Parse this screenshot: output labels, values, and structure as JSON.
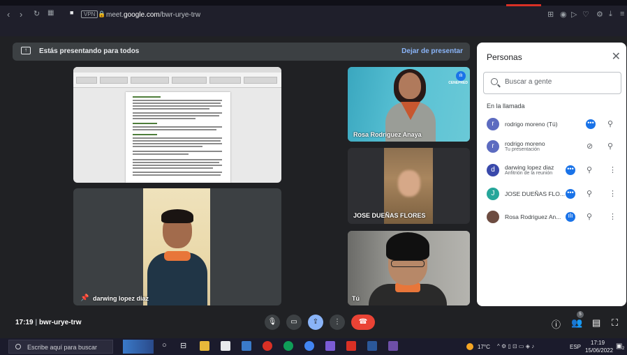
{
  "browser": {
    "url_prefix": "meet.",
    "url_domain": "google.com",
    "url_path": "/bwr-urye-trw",
    "vpn_label": "VPN"
  },
  "banner": {
    "text": "Estás presentando para todos",
    "stop_label": "Dejar de presentar"
  },
  "tiles": {
    "rosa": "Rosa Rodriguez Anaya",
    "rosa_logo": "CENEPRED",
    "jose": "JOSE DUEÑAS FLORES",
    "darwing": "darwing lopez diaz",
    "you": "Tú"
  },
  "people": {
    "title": "Personas",
    "search_placeholder": "Buscar a gente",
    "in_call": "En la llamada",
    "list": [
      {
        "initial": "r",
        "name": "rodrigo moreno (Tú)",
        "sub": "",
        "color": "#5c6bc0"
      },
      {
        "initial": "r",
        "name": "rodrigo moreno",
        "sub": "Tu presentación",
        "color": "#5c6bc0"
      },
      {
        "initial": "d",
        "name": "darwing lopez diaz",
        "sub": "Anfitrión de la reunión",
        "color": "#3949ab"
      },
      {
        "initial": "J",
        "name": "JOSE DUEÑAS FLO...",
        "sub": "",
        "color": "#26a69a"
      },
      {
        "initial": "",
        "name": "Rosa Rodriguez An...",
        "sub": "",
        "color": "#6d4c41"
      }
    ]
  },
  "meeting": {
    "time": "17:19",
    "separator": "|",
    "code": "bwr-urye-trw",
    "participants": "5"
  },
  "taskbar": {
    "search": "Escribe aquí para buscar",
    "temperature": "17°C",
    "lang": "ESP",
    "time": "17:19",
    "date": "15/06/2022",
    "notif": "2"
  }
}
